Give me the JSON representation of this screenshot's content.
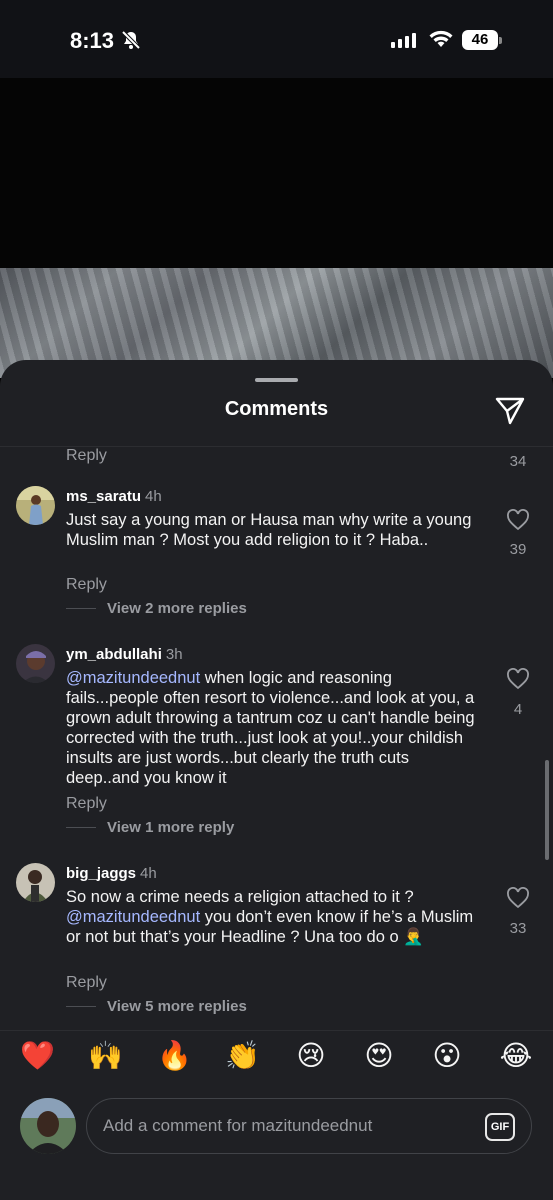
{
  "status_bar": {
    "time": "8:13",
    "battery": "46"
  },
  "sheet": {
    "title": "Comments"
  },
  "top_partial": {
    "reply_label": "Reply",
    "like_count": "34"
  },
  "comments": [
    {
      "username": "ms_saratu",
      "time": "4h",
      "text": "Just say a young man or Hausa man why write a young Muslim man ? Most you add religion to it ? Haba..",
      "likes": "39",
      "reply_label": "Reply",
      "view_replies": "View 2 more replies"
    },
    {
      "username": "ym_abdullahi",
      "time": "3h",
      "mention": "@mazitundeednut",
      "text": "  when logic and reasoning fails...people often resort to violence...and look at you,  a grown adult  throwing a tantrum coz u can't handle being corrected with the truth...just look at you!..your childish insults are just words...but clearly the truth cuts deep..and you know it",
      "likes": "4",
      "reply_label": "Reply",
      "view_replies": "View 1 more reply"
    },
    {
      "username": "big_jaggs",
      "time": "4h",
      "text_before": "So now a crime needs a religion attached to it ? ",
      "mention": "@mazitundeednut",
      "text_after": " you don’t even know if he’s a Muslim or not but that’s your Headline ? Una too do o 🤦‍♂️",
      "likes": "33",
      "reply_label": "Reply",
      "view_replies": "View 5 more replies"
    }
  ],
  "emoji_bar": [
    "❤️",
    "🙌",
    "🔥",
    "👏",
    "😢",
    "😍",
    "😮",
    "😂"
  ],
  "composer": {
    "placeholder": "Add a comment for mazitundeednut",
    "gif_label": "GIF"
  },
  "colors": {
    "sheet_bg": "#1f2024",
    "mention": "#a6b8ff",
    "muted_text": "#9a9ca1"
  }
}
